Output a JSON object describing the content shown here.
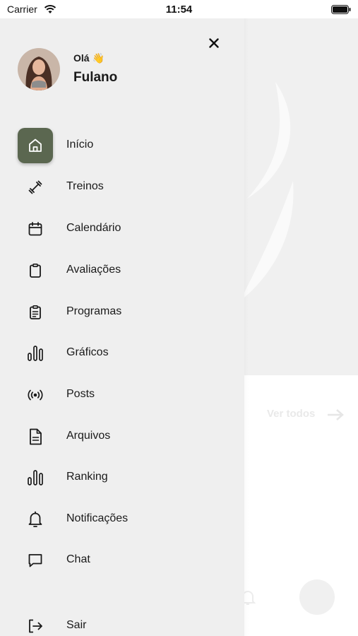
{
  "status_bar": {
    "carrier": "Carrier",
    "time": "11:54",
    "icons": [
      "wifi-icon",
      "battery-icon"
    ]
  },
  "drawer": {
    "close_icon": "close-icon",
    "user": {
      "greeting": "Olá 👋",
      "name": "Fulano"
    },
    "active_color": "#5b6750",
    "items": [
      {
        "label": "Início",
        "icon": "home-icon",
        "active": true
      },
      {
        "label": "Treinos",
        "icon": "dumbbell-icon",
        "active": false
      },
      {
        "label": "Calendário",
        "icon": "calendar-icon",
        "active": false
      },
      {
        "label": "Avaliações",
        "icon": "clipboard-icon",
        "active": false
      },
      {
        "label": "Programas",
        "icon": "clipboard-list-icon",
        "active": false
      },
      {
        "label": "Gráficos",
        "icon": "bar-chart-icon",
        "active": false
      },
      {
        "label": "Posts",
        "icon": "broadcast-icon",
        "active": false
      },
      {
        "label": "Arquivos",
        "icon": "file-icon",
        "active": false
      },
      {
        "label": "Ranking",
        "icon": "bar-chart-icon",
        "active": false
      },
      {
        "label": "Notificações",
        "icon": "bell-icon",
        "active": false
      },
      {
        "label": "Chat",
        "icon": "chat-icon",
        "active": false
      },
      {
        "label": "Sair",
        "icon": "logout-icon",
        "active": false
      }
    ]
  },
  "background": {
    "see_all": "Ver todos"
  }
}
